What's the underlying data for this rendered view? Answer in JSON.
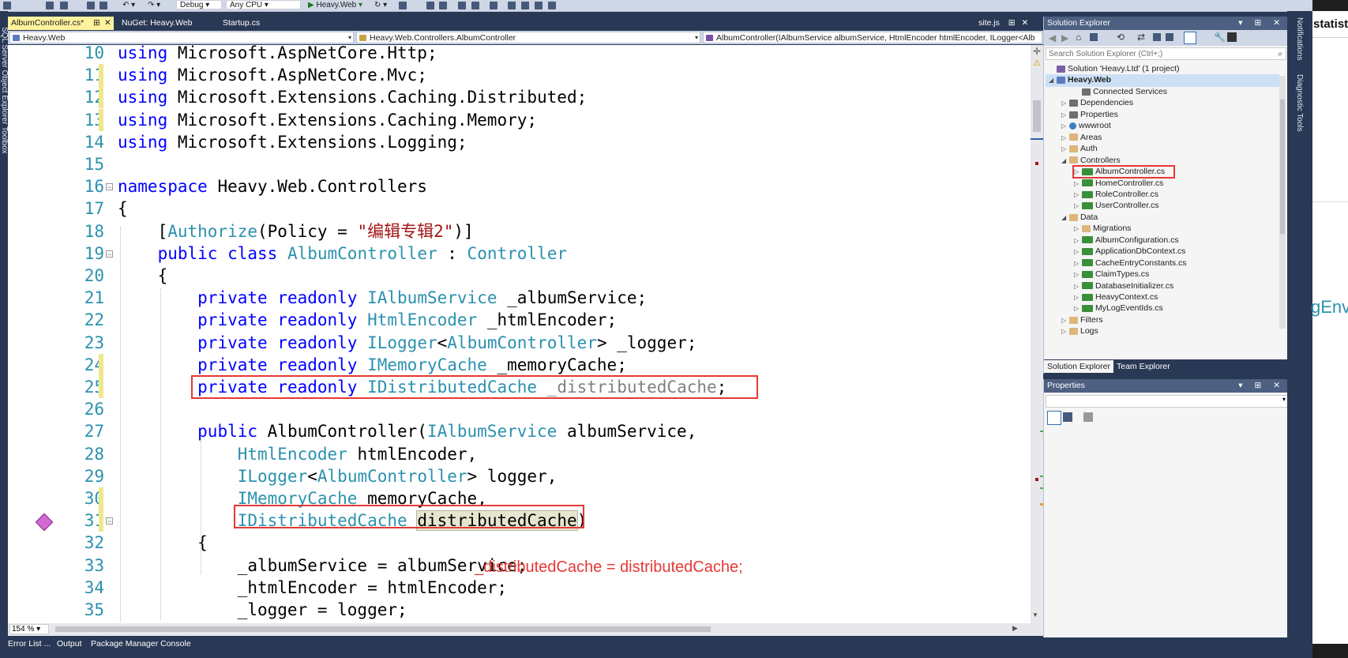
{
  "toolbar": {
    "config": "Debug",
    "platform": "Any CPU",
    "run_target": "Heavy.Web"
  },
  "doc_tabs": [
    {
      "label": "AlbumController.cs*",
      "pin": "⊞",
      "close": "✕",
      "active": true
    },
    {
      "label": "NuGet: Heavy.Web",
      "active": false
    },
    {
      "label": "Startup.cs",
      "active": false
    }
  ],
  "right_tab": {
    "label": "site.js",
    "pin": "⊞",
    "close": "✕"
  },
  "navbar": {
    "project": "Heavy.Web",
    "class": "Heavy.Web.Controllers.AlbumController",
    "member": "AlbumController(IAlbumService albumService, HtmlEncoder htmlEncoder, ILogger<Alb"
  },
  "code_lines": [
    {
      "n": "10",
      "tokens": [
        {
          "t": "using",
          "c": "kw"
        },
        {
          "t": " Microsoft.AspNetCore.Http;"
        }
      ]
    },
    {
      "n": "11",
      "tokens": [
        {
          "t": "using",
          "c": "kw"
        },
        {
          "t": " Microsoft.AspNetCore.Mvc;"
        }
      ]
    },
    {
      "n": "12",
      "tokens": [
        {
          "t": "using",
          "c": "kw"
        },
        {
          "t": " Microsoft.Extensions.Caching.Distributed;"
        }
      ]
    },
    {
      "n": "13",
      "tokens": [
        {
          "t": "using",
          "c": "kw"
        },
        {
          "t": " Microsoft.Extensions.Caching.Memory;"
        }
      ]
    },
    {
      "n": "14",
      "tokens": [
        {
          "t": "using",
          "c": "kw"
        },
        {
          "t": " Microsoft.Extensions.Logging;"
        }
      ]
    },
    {
      "n": "15",
      "tokens": []
    },
    {
      "n": "16",
      "tokens": [
        {
          "t": "namespace",
          "c": "kw"
        },
        {
          "t": " Heavy.Web.Controllers"
        }
      ]
    },
    {
      "n": "17",
      "tokens": [
        {
          "t": "{"
        }
      ]
    },
    {
      "n": "18",
      "tokens": [
        {
          "t": "    ["
        },
        {
          "t": "Authorize",
          "c": "ty"
        },
        {
          "t": "(Policy = "
        },
        {
          "t": "\"编辑专辑2\"",
          "c": "str"
        },
        {
          "t": ")]"
        }
      ]
    },
    {
      "n": "19",
      "tokens": [
        {
          "t": "    "
        },
        {
          "t": "public class",
          "c": "kw"
        },
        {
          "t": " "
        },
        {
          "t": "AlbumController",
          "c": "ty"
        },
        {
          "t": " : "
        },
        {
          "t": "Controller",
          "c": "ty"
        }
      ]
    },
    {
      "n": "20",
      "tokens": [
        {
          "t": "    {"
        }
      ]
    },
    {
      "n": "21",
      "tokens": [
        {
          "t": "        "
        },
        {
          "t": "private readonly",
          "c": "kw"
        },
        {
          "t": " "
        },
        {
          "t": "IAlbumService",
          "c": "ty"
        },
        {
          "t": " _albumService;"
        }
      ]
    },
    {
      "n": "22",
      "tokens": [
        {
          "t": "        "
        },
        {
          "t": "private readonly",
          "c": "kw"
        },
        {
          "t": " "
        },
        {
          "t": "HtmlEncoder",
          "c": "ty"
        },
        {
          "t": " _htmlEncoder;"
        }
      ]
    },
    {
      "n": "23",
      "tokens": [
        {
          "t": "        "
        },
        {
          "t": "private readonly",
          "c": "kw"
        },
        {
          "t": " "
        },
        {
          "t": "ILogger",
          "c": "ty"
        },
        {
          "t": "<"
        },
        {
          "t": "AlbumController",
          "c": "ty"
        },
        {
          "t": "> _logger;"
        }
      ]
    },
    {
      "n": "24",
      "tokens": [
        {
          "t": "        "
        },
        {
          "t": "private readonly",
          "c": "kw"
        },
        {
          "t": " "
        },
        {
          "t": "IMemoryCache",
          "c": "ty"
        },
        {
          "t": " _memoryCache;"
        }
      ]
    },
    {
      "n": "25",
      "tokens": [
        {
          "t": "        "
        },
        {
          "t": "private readonly",
          "c": "kw"
        },
        {
          "t": " "
        },
        {
          "t": "IDistributedCache",
          "c": "ty"
        },
        {
          "t": " "
        },
        {
          "t": "_distributedCache",
          "c": "gr"
        },
        {
          "t": ";"
        }
      ]
    },
    {
      "n": "26",
      "tokens": []
    },
    {
      "n": "27",
      "tokens": [
        {
          "t": "        "
        },
        {
          "t": "public",
          "c": "kw"
        },
        {
          "t": " AlbumController("
        },
        {
          "t": "IAlbumService",
          "c": "ty"
        },
        {
          "t": " albumService,"
        }
      ]
    },
    {
      "n": "28",
      "tokens": [
        {
          "t": "            "
        },
        {
          "t": "HtmlEncoder",
          "c": "ty"
        },
        {
          "t": " htmlEncoder,"
        }
      ]
    },
    {
      "n": "29",
      "tokens": [
        {
          "t": "            "
        },
        {
          "t": "ILogger",
          "c": "ty"
        },
        {
          "t": "<"
        },
        {
          "t": "AlbumController",
          "c": "ty"
        },
        {
          "t": "> logger,"
        }
      ]
    },
    {
      "n": "30",
      "tokens": [
        {
          "t": "            "
        },
        {
          "t": "IMemoryCache",
          "c": "ty"
        },
        {
          "t": " memoryCache,"
        }
      ]
    },
    {
      "n": "31",
      "tokens": [
        {
          "t": "            "
        },
        {
          "t": "IDistributedCache",
          "c": "ty"
        },
        {
          "t": " "
        },
        {
          "t": "distributedCache",
          "c": "hl"
        },
        {
          "t": ")"
        }
      ]
    },
    {
      "n": "32",
      "tokens": [
        {
          "t": "        {"
        }
      ]
    },
    {
      "n": "33",
      "tokens": [
        {
          "t": "            _albumService = albumService;"
        }
      ]
    },
    {
      "n": "34",
      "tokens": [
        {
          "t": "            _htmlEncoder = htmlEncoder;"
        }
      ]
    },
    {
      "n": "35",
      "tokens": [
        {
          "t": "            _logger = logger;"
        }
      ]
    }
  ],
  "annotation_text": "_distributedCache = distributedCache;",
  "zoom": "154 %",
  "solution_explorer": {
    "title": "Solution Explorer",
    "search_placeholder": "Search Solution Explorer (Ctrl+;)",
    "items": [
      {
        "label": "Solution 'Heavy.Ltd' (1 project)",
        "icon": "sol",
        "indent": 0,
        "tri": ""
      },
      {
        "label": "Heavy.Web",
        "icon": "proj",
        "indent": 0,
        "tri": "◢",
        "bold": true,
        "sel": true
      },
      {
        "label": "Connected Services",
        "icon": "props",
        "indent": 2,
        "tri": ""
      },
      {
        "label": "Dependencies",
        "icon": "props",
        "indent": 1,
        "tri": "▷"
      },
      {
        "label": "Properties",
        "icon": "props",
        "indent": 1,
        "tri": "▷"
      },
      {
        "label": "wwwroot",
        "icon": "globe",
        "indent": 1,
        "tri": "▷"
      },
      {
        "label": "Areas",
        "icon": "folder",
        "indent": 1,
        "tri": "▷"
      },
      {
        "label": "Auth",
        "icon": "folder",
        "indent": 1,
        "tri": "▷"
      },
      {
        "label": "Controllers",
        "icon": "folder",
        "indent": 1,
        "tri": "◢"
      },
      {
        "label": "AlbumController.cs",
        "icon": "csfile",
        "indent": 2,
        "tri": "▷",
        "boxed": true
      },
      {
        "label": "HomeController.cs",
        "icon": "csfile",
        "indent": 2,
        "tri": "▷"
      },
      {
        "label": "RoleController.cs",
        "icon": "csfile",
        "indent": 2,
        "tri": "▷"
      },
      {
        "label": "UserController.cs",
        "icon": "csfile",
        "indent": 2,
        "tri": "▷"
      },
      {
        "label": "Data",
        "icon": "folder",
        "indent": 1,
        "tri": "◢"
      },
      {
        "label": "Migrations",
        "icon": "folder",
        "indent": 2,
        "tri": "▷"
      },
      {
        "label": "AlbumConfiguration.cs",
        "icon": "csfile",
        "indent": 2,
        "tri": "▷"
      },
      {
        "label": "ApplicationDbContext.cs",
        "icon": "csfile",
        "indent": 2,
        "tri": "▷"
      },
      {
        "label": "CacheEntryConstants.cs",
        "icon": "csfile",
        "indent": 2,
        "tri": "▷"
      },
      {
        "label": "ClaimTypes.cs",
        "icon": "csfile",
        "indent": 2,
        "tri": "▷"
      },
      {
        "label": "DatabaseInitializer.cs",
        "icon": "csfile",
        "indent": 2,
        "tri": "▷"
      },
      {
        "label": "HeavyContext.cs",
        "icon": "csfile",
        "indent": 2,
        "tri": "▷"
      },
      {
        "label": "MyLogEventIds.cs",
        "icon": "csfile",
        "indent": 2,
        "tri": "▷"
      },
      {
        "label": "Filters",
        "icon": "folder",
        "indent": 1,
        "tri": "▷"
      },
      {
        "label": "Logs",
        "icon": "folder",
        "indent": 1,
        "tri": "▷"
      }
    ],
    "tabs": [
      "Solution Explorer",
      "Team Explorer"
    ],
    "title_controls": "▾ ⊞ ✕"
  },
  "properties": {
    "title": "Properties",
    "title_controls": "▾ ⊞ ✕"
  },
  "bottom_tabs": [
    "Error List ...",
    "Output",
    "Package Manager Console"
  ],
  "right_strip": [
    "Notifications",
    "Diagnostic Tools"
  ],
  "left_strip": "SQL Server Object Explorer  Toolbox",
  "far_right": {
    "top": "statisti",
    "mid": "gEnv"
  }
}
